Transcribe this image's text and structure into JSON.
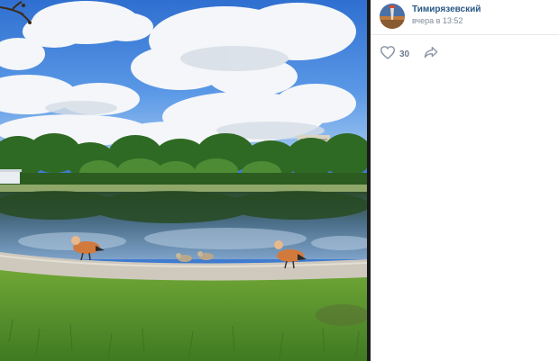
{
  "post": {
    "author_name": "Тимирязевский",
    "date": "вчера в 13:52",
    "likes": "30"
  },
  "icons": {
    "like": "heart-outline-icon",
    "share": "share-arrow-icon"
  },
  "colors": {
    "author_link": "#2a5885",
    "meta_gray": "#818c99",
    "icon_gray": "#8a95a3",
    "divider": "#1a1a1a"
  }
}
